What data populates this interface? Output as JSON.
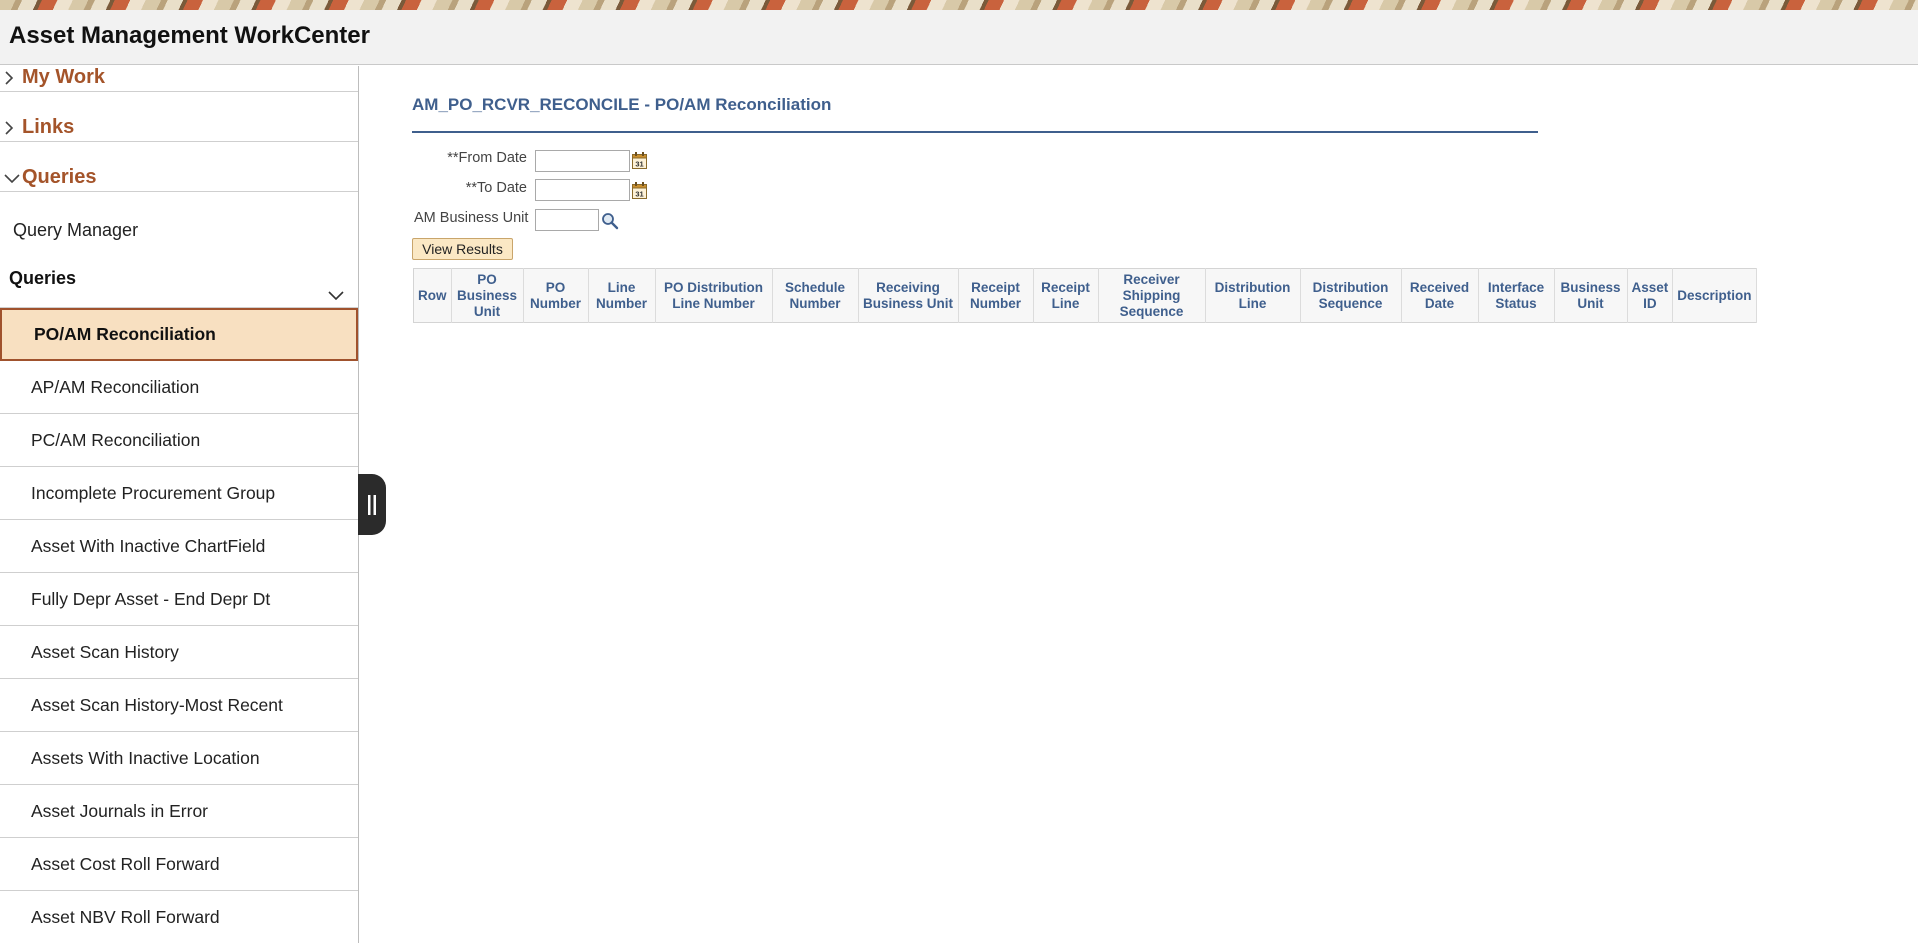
{
  "header": {
    "title": "Asset Management WorkCenter"
  },
  "sidebar": {
    "sections": {
      "my_work": "My Work",
      "links": "Links",
      "queries": "Queries"
    },
    "query_manager": "Query Manager",
    "queries_group": "Queries",
    "items": [
      {
        "label": "PO/AM Reconciliation",
        "selected": true
      },
      {
        "label": "AP/AM Reconciliation"
      },
      {
        "label": "PC/AM Reconciliation"
      },
      {
        "label": "Incomplete Procurement Group"
      },
      {
        "label": "Asset With Inactive ChartField"
      },
      {
        "label": "Fully Depr Asset - End Depr Dt"
      },
      {
        "label": "Asset Scan History"
      },
      {
        "label": "Asset Scan History-Most Recent"
      },
      {
        "label": "Assets With Inactive Location"
      },
      {
        "label": "Asset Journals in Error"
      },
      {
        "label": "Asset Cost Roll Forward"
      },
      {
        "label": "Asset NBV Roll Forward"
      }
    ]
  },
  "main": {
    "page_title": "AM_PO_RCVR_RECONCILE - PO/AM Reconciliation",
    "form": {
      "from_date_label": "**From Date",
      "from_date_value": "",
      "to_date_label": "**To Date",
      "to_date_value": "",
      "business_unit_label": "AM Business Unit",
      "business_unit_value": ""
    },
    "view_results_label": "View Results",
    "table": {
      "columns": [
        "Row",
        "PO Business Unit",
        "PO Number",
        "Line Number",
        "PO Distribution Line Number",
        "Schedule Number",
        "Receiving Business Unit",
        "Receipt Number",
        "Receipt Line",
        "Receiver Shipping Sequence",
        "Distribution Line",
        "Distribution Sequence",
        "Received Date",
        "Interface Status",
        "Business Unit",
        "Asset ID",
        "Description"
      ]
    }
  },
  "colors": {
    "accent_brown": "#a4542a",
    "title_blue": "#3f5f8d",
    "selected_bg": "#f8e0c1"
  }
}
